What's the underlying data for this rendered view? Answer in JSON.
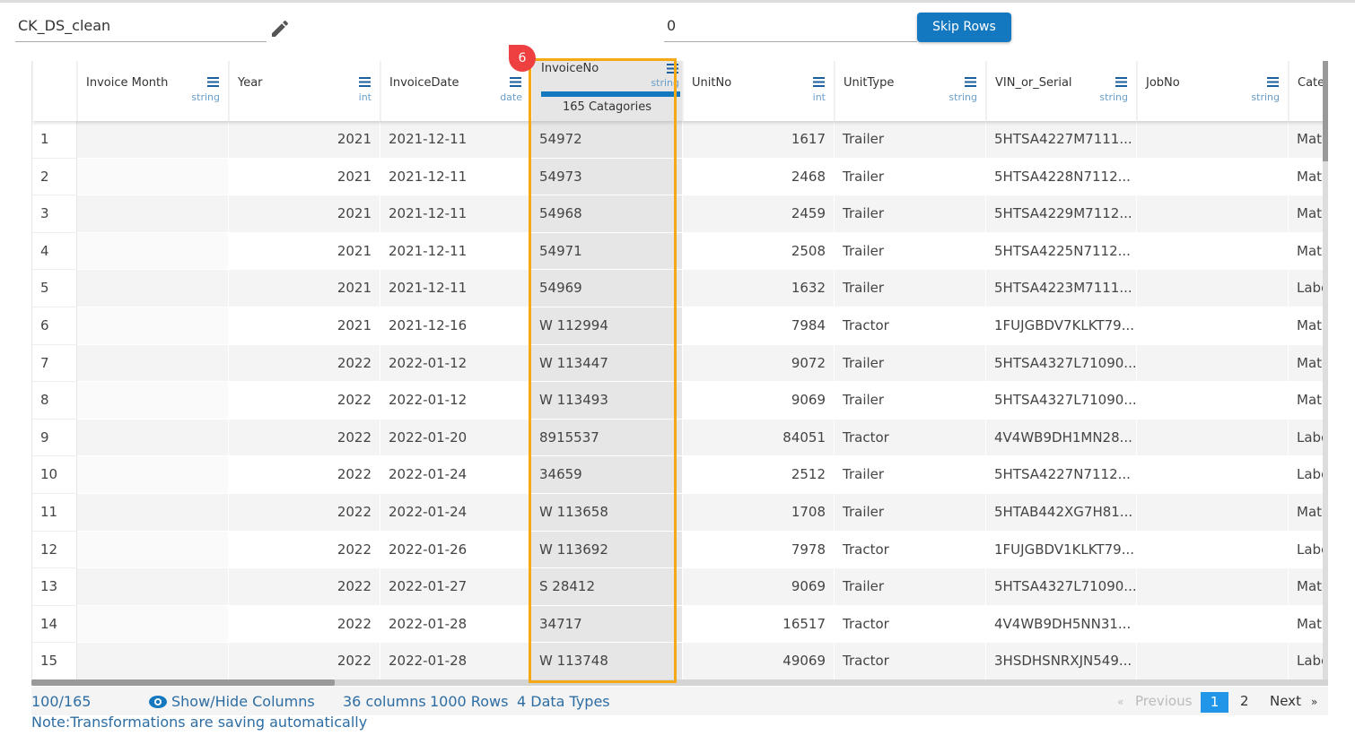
{
  "toolbar": {
    "dataset_name": "CK_DS_clean",
    "skip_rows_value": "0",
    "skip_rows_label": "Skip Rows"
  },
  "colors": {
    "accent": "#1478c0",
    "selection": "#f5a914",
    "badge": "#ee4040"
  },
  "selected_column": {
    "badge": "6",
    "categories": "165 Catagories"
  },
  "columns": [
    {
      "name": "Invoice Month",
      "type": "string"
    },
    {
      "name": "Year",
      "type": "int"
    },
    {
      "name": "InvoiceDate",
      "type": "date"
    },
    {
      "name": "InvoiceNo",
      "type": "string"
    },
    {
      "name": "UnitNo",
      "type": "int"
    },
    {
      "name": "UnitType",
      "type": "string"
    },
    {
      "name": "VIN_or_Serial",
      "type": "string"
    },
    {
      "name": "JobNo",
      "type": "string"
    },
    {
      "name": "Cate",
      "type": ""
    }
  ],
  "rows": [
    [
      "1",
      "",
      "2021",
      "2021-12-11",
      "54972",
      "1617",
      "Trailer",
      "5HTSA4227M7111...",
      "",
      "Mate"
    ],
    [
      "2",
      "",
      "2021",
      "2021-12-11",
      "54973",
      "2468",
      "Trailer",
      "5HTSA4228N7112...",
      "",
      "Mate"
    ],
    [
      "3",
      "",
      "2021",
      "2021-12-11",
      "54968",
      "2459",
      "Trailer",
      "5HTSA4229M7112...",
      "",
      "Mate"
    ],
    [
      "4",
      "",
      "2021",
      "2021-12-11",
      "54971",
      "2508",
      "Trailer",
      "5HTSA4225N7112...",
      "",
      "Mate"
    ],
    [
      "5",
      "",
      "2021",
      "2021-12-11",
      "54969",
      "1632",
      "Trailer",
      "5HTSA4223M7111...",
      "",
      "Labo"
    ],
    [
      "6",
      "",
      "2021",
      "2021-12-16",
      "W 112994",
      "7984",
      "Tractor",
      "1FUJGBDV7KLKT79...",
      "",
      "Mate"
    ],
    [
      "7",
      "",
      "2022",
      "2022-01-12",
      "W 113447",
      "9072",
      "Trailer",
      "5HTSA4327L71090...",
      "",
      "Mate"
    ],
    [
      "8",
      "",
      "2022",
      "2022-01-12",
      "W 113493",
      "9069",
      "Trailer",
      "5HTSA4327L71090...",
      "",
      "Mate"
    ],
    [
      "9",
      "",
      "2022",
      "2022-01-20",
      "8915537",
      "84051",
      "Tractor",
      "4V4WB9DH1MN28...",
      "",
      "Labo"
    ],
    [
      "10",
      "",
      "2022",
      "2022-01-24",
      "34659",
      "2512",
      "Trailer",
      "5HTSA4227N7112...",
      "",
      "Labo"
    ],
    [
      "11",
      "",
      "2022",
      "2022-01-24",
      "W 113658",
      "1708",
      "Trailer",
      "5HTAB442XG7H81...",
      "",
      "Mate"
    ],
    [
      "12",
      "",
      "2022",
      "2022-01-26",
      "W 113692",
      "7978",
      "Tractor",
      "1FUJGBDV1KLKT79...",
      "",
      "Labo"
    ],
    [
      "13",
      "",
      "2022",
      "2022-01-27",
      "S 28412",
      "9069",
      "Trailer",
      "5HTSA4327L71090...",
      "",
      "Mate"
    ],
    [
      "14",
      "",
      "2022",
      "2022-01-28",
      "34717",
      "16517",
      "Tractor",
      "4V4WB9DH5NN31...",
      "",
      "Mate"
    ],
    [
      "15",
      "",
      "2022",
      "2022-01-28",
      "W 113748",
      "49069",
      "Tractor",
      "3HSDHSNRXJN549...",
      "",
      "Labo"
    ]
  ],
  "footer": {
    "count": "100/165",
    "show_hide": "Show/Hide Columns",
    "columns": "36 columns",
    "rows": "1000 Rows",
    "types": "4 Data Types",
    "previous": "Previous",
    "page1": "1",
    "page2": "2",
    "next": "Next",
    "prev_glyph": "«",
    "next_glyph": "»"
  },
  "note": "Note:Transformations are saving automatically"
}
